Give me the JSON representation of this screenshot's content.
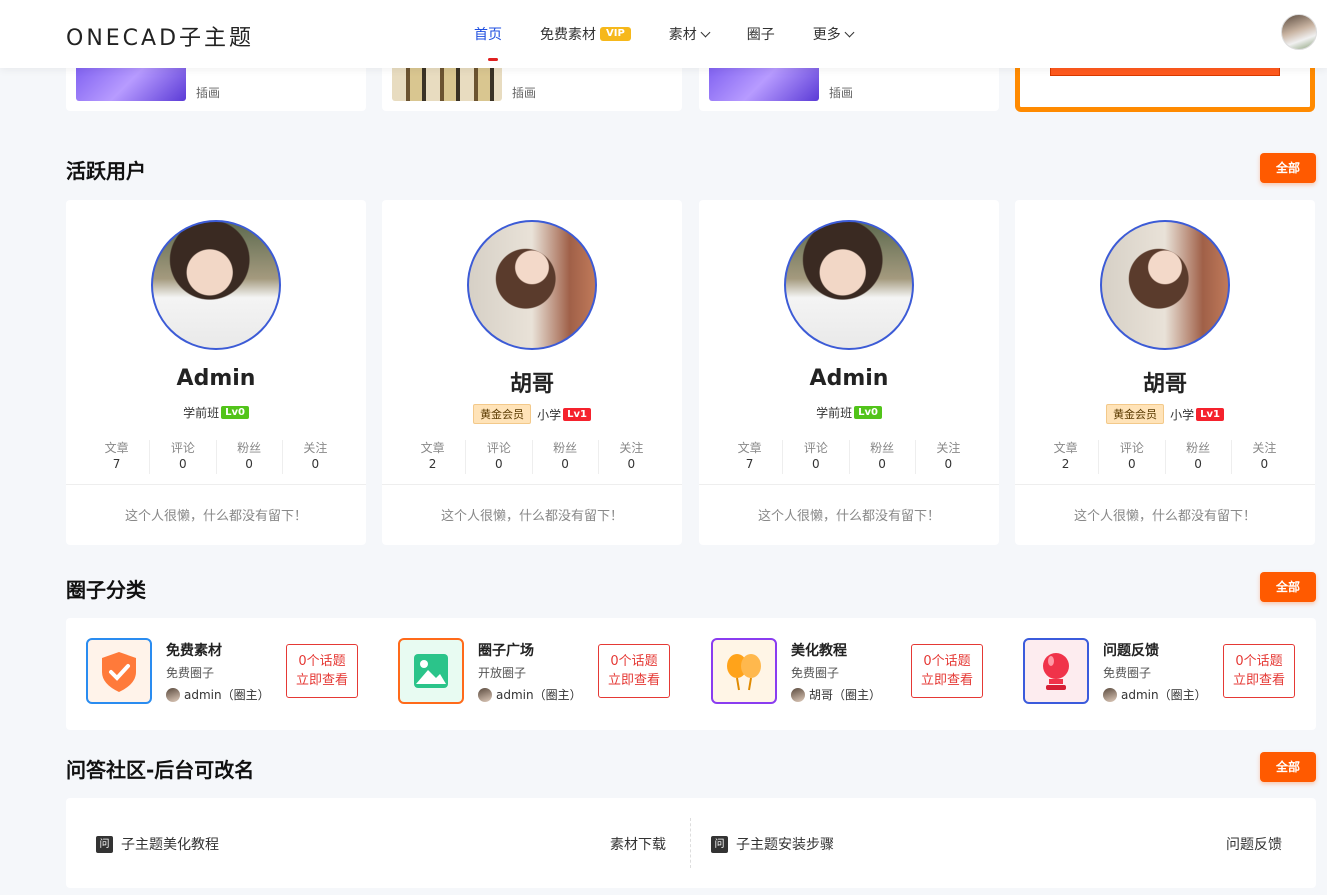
{
  "header": {
    "logo": "ONECAD子主题",
    "nav": [
      {
        "label": "首页",
        "active": true
      },
      {
        "label": "免费素材",
        "badge": "VIP"
      },
      {
        "label": "素材",
        "dropdown": true
      },
      {
        "label": "圈子"
      },
      {
        "label": "更多",
        "dropdown": true
      }
    ]
  },
  "strip": {
    "items": [
      {
        "tag": "插画"
      },
      {
        "tag": "插画"
      },
      {
        "tag": "插画"
      }
    ]
  },
  "active_users": {
    "title": "活跃用户",
    "all_label": "全部",
    "stat_labels": [
      "文章",
      "评论",
      "粉丝",
      "关注"
    ],
    "users": [
      {
        "name": "Admin",
        "role": "学前班",
        "member": "",
        "level": "Lv0",
        "stats": [
          "7",
          "0",
          "0",
          "0"
        ],
        "desc": "这个人很懒，什么都没有留下！"
      },
      {
        "name": "胡哥",
        "role": "小学",
        "member": "黄金会员",
        "level": "Lv1",
        "stats": [
          "2",
          "0",
          "0",
          "0"
        ],
        "desc": "这个人很懒，什么都没有留下！"
      },
      {
        "name": "Admin",
        "role": "学前班",
        "member": "",
        "level": "Lv0",
        "stats": [
          "7",
          "0",
          "0",
          "0"
        ],
        "desc": "这个人很懒，什么都没有留下！"
      },
      {
        "name": "胡哥",
        "role": "小学",
        "member": "黄金会员",
        "level": "Lv1",
        "stats": [
          "2",
          "0",
          "0",
          "0"
        ],
        "desc": "这个人很懒，什么都没有留下！"
      }
    ]
  },
  "circles": {
    "title": "圈子分类",
    "all_label": "全部",
    "items": [
      {
        "name": "免费素材",
        "type": "免费圈子",
        "owner": "admin（圈主）",
        "btn_line1": "0个话题",
        "btn_line2": "立即查看",
        "icon": "shield-check-icon",
        "color": "#2a8cf0"
      },
      {
        "name": "圈子广场",
        "type": "开放圈子",
        "owner": "admin（圈主）",
        "btn_line1": "0个话题",
        "btn_line2": "立即查看",
        "icon": "image-icon",
        "color": "#ff6a1a"
      },
      {
        "name": "美化教程",
        "type": "免费圈子",
        "owner": "胡哥（圈主）",
        "btn_line1": "0个话题",
        "btn_line2": "立即查看",
        "icon": "balloon-icon",
        "color": "#8a3cf0"
      },
      {
        "name": "问题反馈",
        "type": "免费圈子",
        "owner": "admin（圈主）",
        "btn_line1": "0个话题",
        "btn_line2": "立即查看",
        "icon": "bulb-icon",
        "color": "#3b5bdc"
      }
    ]
  },
  "qa": {
    "title": "问答社区-后台可改名",
    "all_label": "全部",
    "icon_char": "问",
    "items": [
      {
        "question": "子主题美化教程",
        "tag": "素材下载"
      },
      {
        "question": "子主题安装步骤",
        "tag": "问题反馈"
      }
    ]
  }
}
